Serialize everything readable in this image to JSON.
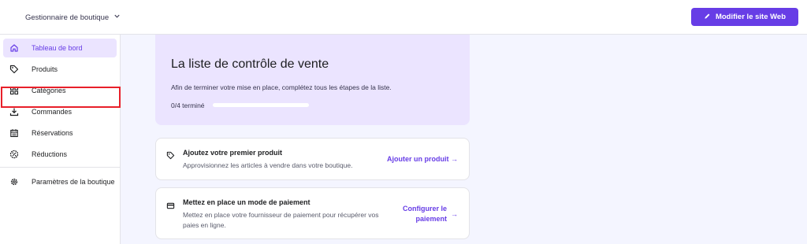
{
  "header": {
    "store_name": "Gestionnaire de boutique",
    "edit_site_label": "Modifier le site Web"
  },
  "sidebar": {
    "items": [
      {
        "label": "Tableau de bord",
        "icon": "home-icon",
        "active": true
      },
      {
        "label": "Produits",
        "icon": "tag-icon"
      },
      {
        "label": "Catégories",
        "icon": "grid-icon"
      },
      {
        "label": "Commandes",
        "icon": "download-icon"
      },
      {
        "label": "Réservations",
        "icon": "calendar-icon"
      },
      {
        "label": "Réductions",
        "icon": "discount-icon"
      },
      {
        "label": "Paramètres de la boutique",
        "icon": "gear-icon"
      }
    ]
  },
  "checklist": {
    "title": "La liste de contrôle de vente",
    "description": "Afin de terminer votre mise en place, complétez tous les étapes de la liste.",
    "progress_text": "0/4 terminé",
    "progress_value": 0
  },
  "tasks": [
    {
      "icon": "tag-icon",
      "title": "Ajoutez votre premier produit",
      "description": "Approvisionnez les articles à vendre dans votre boutique.",
      "action": "Ajouter un produit",
      "action_arrow": "→"
    },
    {
      "icon": "card-icon",
      "title": "Mettez en place un mode de paiement",
      "description_line1": "Mettez en place votre fournisseur de paiement pour récupérer vos",
      "description_line2": "paies en ligne.",
      "action_line1": "Configurer le",
      "action_line2": "paiement",
      "action_arrow": "→"
    }
  ],
  "colors": {
    "accent": "#673de6",
    "accent_light": "#ebe4ff",
    "highlight": "#e8202a"
  }
}
